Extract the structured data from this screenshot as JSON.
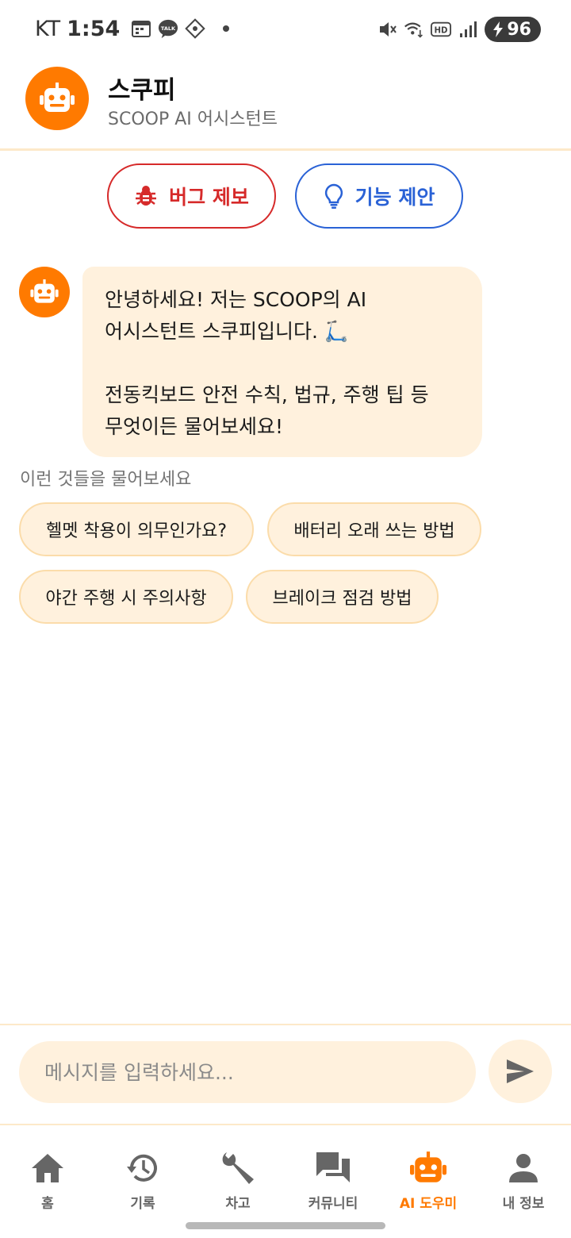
{
  "status_bar": {
    "carrier": "KT",
    "time": "1:54",
    "battery": "96",
    "icons": [
      "calendar-icon",
      "talk-icon",
      "app-icon",
      "mute-icon",
      "wifi-icon",
      "hd-icon",
      "signal-icon",
      "charging-icon"
    ]
  },
  "header": {
    "title": "스쿠피",
    "subtitle": "SCOOP AI 어시스턴트"
  },
  "actions": {
    "bug_label": "버그 제보",
    "idea_label": "기능 제안"
  },
  "chat": {
    "messages": [
      {
        "line1": "안녕하세요! 저는 SCOOP의 AI",
        "line2": "어시스턴트 스쿠피입니다. 🛴",
        "line3": "",
        "line4": "전동킥보드 안전 수칙, 법규, 주행 팁 등",
        "line5": "무엇이든 물어보세요!"
      }
    ]
  },
  "suggestions": {
    "label": "이런 것들을 물어보세요",
    "items": [
      "헬멧 착용이 의무인가요?",
      "배터리 오래 쓰는 방법",
      "야간 주행 시 주의사항",
      "브레이크 점검 방법"
    ]
  },
  "input": {
    "placeholder": "메시지를 입력하세요...",
    "value": ""
  },
  "nav": {
    "items": [
      {
        "label": "홈",
        "icon": "home-icon"
      },
      {
        "label": "기록",
        "icon": "history-icon"
      },
      {
        "label": "차고",
        "icon": "wrench-icon"
      },
      {
        "label": "커뮤니티",
        "icon": "forum-icon"
      },
      {
        "label": "AI 도우미",
        "icon": "robot-icon",
        "active": true
      },
      {
        "label": "내 정보",
        "icon": "person-icon"
      }
    ]
  },
  "colors": {
    "accent": "#ff7a00",
    "bug": "#d62a2a",
    "idea": "#2a62d6",
    "bubble": "#fff1dd",
    "chip_border": "#fbdcaa"
  }
}
